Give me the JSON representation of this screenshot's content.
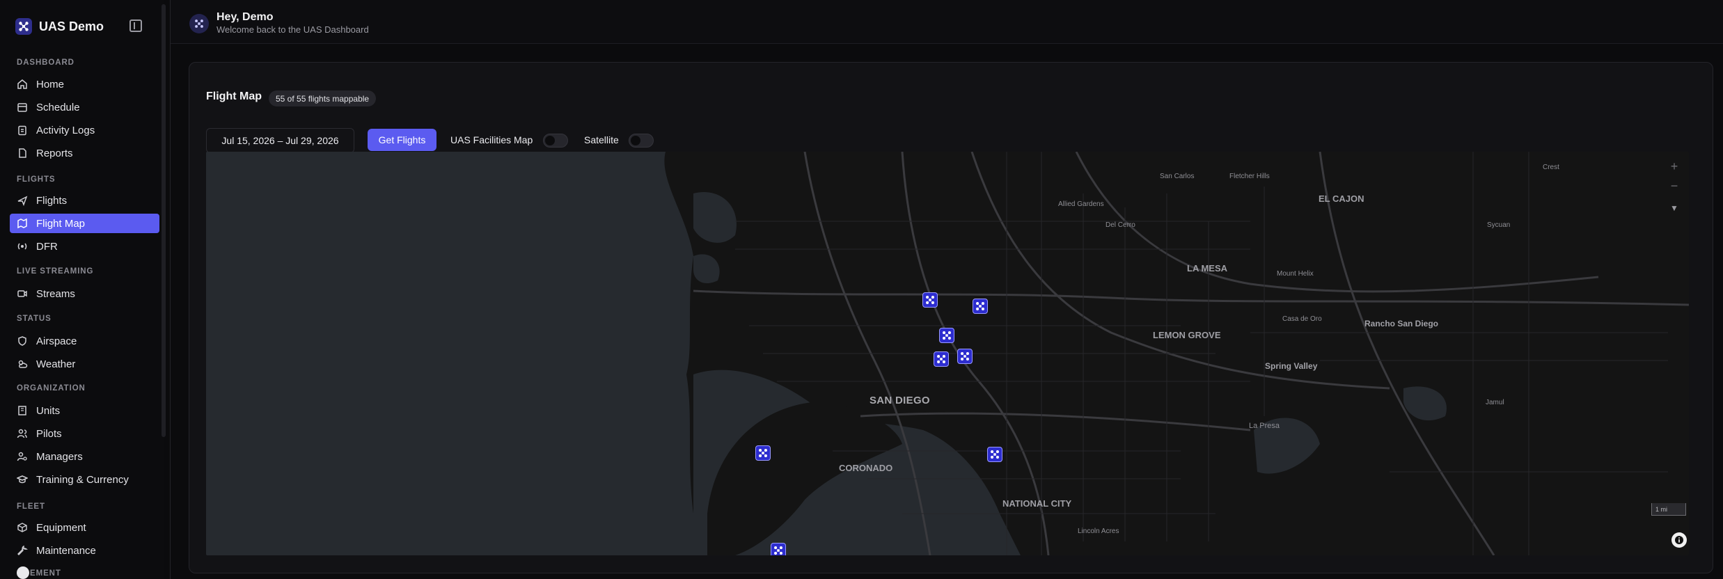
{
  "app": {
    "name": "UAS Demo"
  },
  "header": {
    "greeting": "Hey, Demo",
    "subtitle": "Welcome back to the UAS Dashboard"
  },
  "sidebar": {
    "sections": [
      {
        "title": "DASHBOARD",
        "items": [
          {
            "label": "Home",
            "icon": "home-icon"
          },
          {
            "label": "Schedule",
            "icon": "calendar-icon"
          },
          {
            "label": "Activity Logs",
            "icon": "clipboard-icon"
          },
          {
            "label": "Reports",
            "icon": "file-icon"
          }
        ]
      },
      {
        "title": "FLIGHTS",
        "items": [
          {
            "label": "Flights",
            "icon": "plane-icon"
          },
          {
            "label": "Flight Map",
            "icon": "map-icon",
            "active": true
          },
          {
            "label": "DFR",
            "icon": "radio-icon"
          }
        ]
      },
      {
        "title": "LIVE STREAMING",
        "items": [
          {
            "label": "Streams",
            "icon": "video-icon"
          }
        ]
      },
      {
        "title": "STATUS",
        "items": [
          {
            "label": "Airspace",
            "icon": "shield-icon"
          },
          {
            "label": "Weather",
            "icon": "weather-icon"
          }
        ]
      },
      {
        "title": "ORGANIZATION",
        "items": [
          {
            "label": "Units",
            "icon": "building-icon"
          },
          {
            "label": "Pilots",
            "icon": "users-icon"
          },
          {
            "label": "Managers",
            "icon": "user-cog-icon"
          },
          {
            "label": "Training & Currency",
            "icon": "graduation-cap-icon"
          }
        ]
      },
      {
        "title": "FLEET",
        "items": [
          {
            "label": "Equipment",
            "icon": "box-icon"
          },
          {
            "label": "Maintenance",
            "icon": "wrench-icon"
          }
        ]
      },
      {
        "title": "AGEMENT",
        "items": []
      }
    ]
  },
  "flight_map": {
    "title": "Flight Map",
    "badge": "55 of 55 flights mappable",
    "date_range": "Jul 15, 2026 – Jul 29, 2026",
    "get_flights_label": "Get Flights",
    "facilities_toggle_label": "UAS Facilities Map",
    "facilities_toggle_on": false,
    "satellite_toggle_label": "Satellite",
    "satellite_toggle_on": false,
    "scale_label": "1 mi",
    "zoom_in_label": "+",
    "zoom_out_label": "−",
    "compass_label": "▼",
    "places": {
      "san_diego": "SAN DIEGO",
      "coronado": "CORONADO",
      "national_city": "NATIONAL CITY",
      "la_mesa": "LA MESA",
      "lemon_grove": "LEMON GROVE",
      "el_cajon": "EL CAJON",
      "rancho_san_diego": "Rancho San Diego",
      "spring_valley": "Spring Valley",
      "la_presa": "La Presa",
      "san_carlos": "San Carlos",
      "fletcher_hills": "Fletcher Hills",
      "crest": "Crest",
      "allied_gardens": "Allied Gardens",
      "del_cerro": "Del Cerro",
      "mount_helix": "Mount Helix",
      "casa_de_oro": "Casa de Oro",
      "sycuan": "Sycuan",
      "jamul": "Jamul",
      "lincoln_acres": "Lincoln Acres"
    }
  }
}
